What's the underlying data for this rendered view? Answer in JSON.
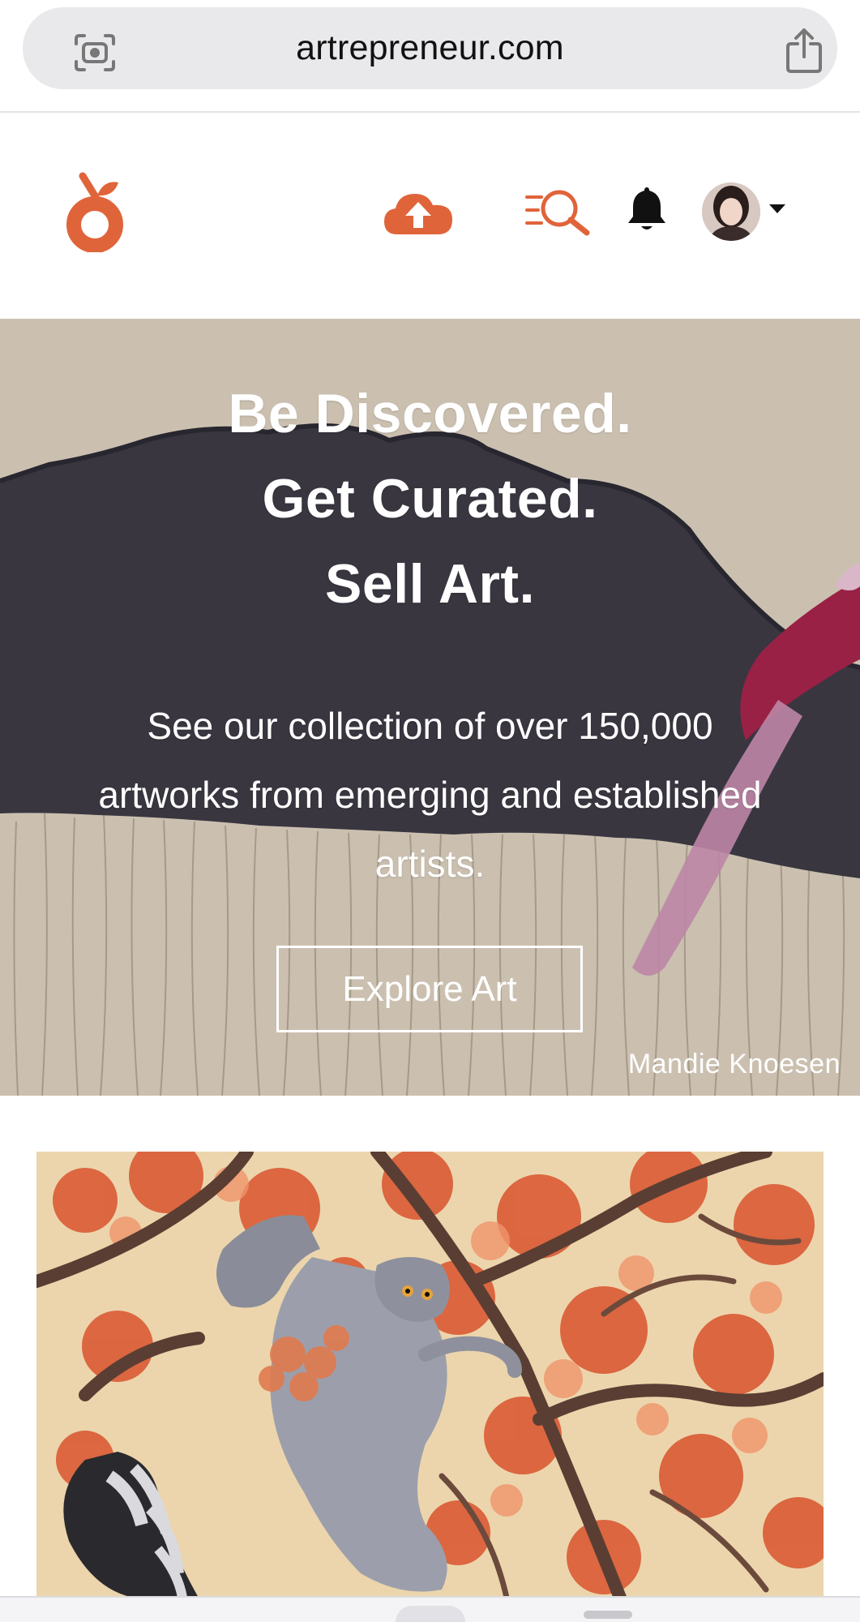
{
  "browser": {
    "url": "artrepreneur.com",
    "lens_icon": "camera-lens-icon",
    "share_icon": "share-icon"
  },
  "header": {
    "logo_icon": "orange-fruit-logo-icon",
    "upload_icon": "cloud-upload-icon",
    "search_icon": "search-list-icon",
    "notifications_icon": "bell-icon",
    "account_caret_icon": "caret-down-icon"
  },
  "hero": {
    "line1": "Be Discovered.",
    "line2": "Get Curated.",
    "line3": "Sell Art.",
    "subtitle": "See our collection of over 150,000 artworks from emerging and established artists.",
    "button_label": "Explore Art",
    "credit": "Mandie Knoesen"
  },
  "colors": {
    "brand_orange": "#e0643a",
    "bell_black": "#111111",
    "address_bar_bg": "#e9e9ec"
  }
}
